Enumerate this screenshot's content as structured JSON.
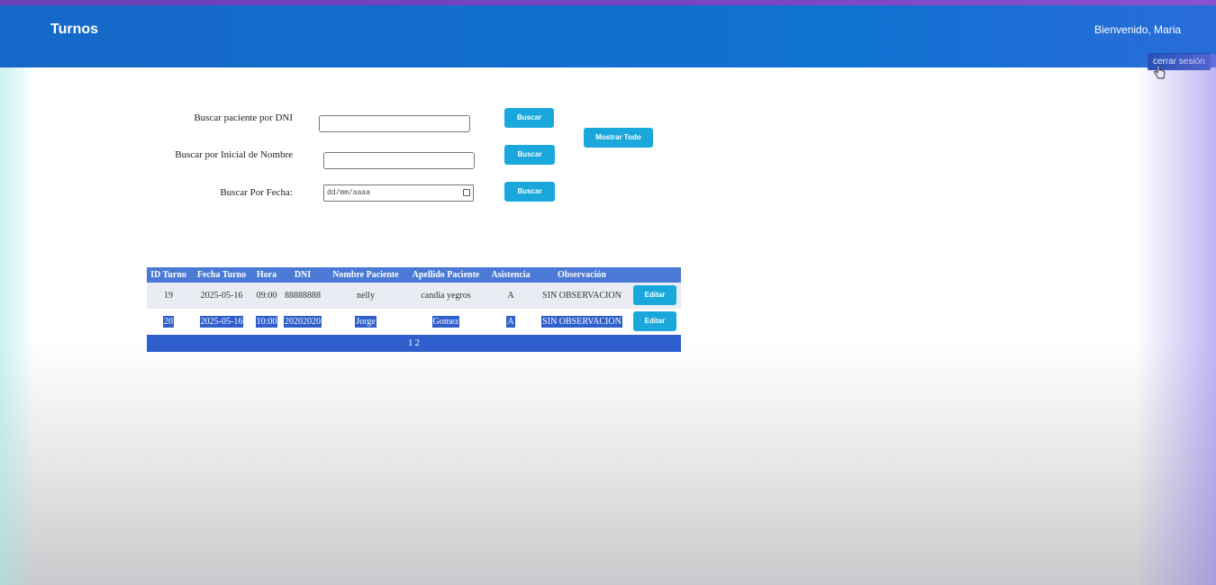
{
  "header": {
    "title": "Turnos",
    "welcome": "Bienvenido, Maria",
    "logout_label": "cerrar sesión"
  },
  "search": {
    "dni_label": "Buscar  paciente por DNI",
    "dni_value": "",
    "name_label": "Buscar por Inicial de Nombre",
    "name_value": "",
    "date_label": "Buscar Por Fecha:",
    "date_placeholder": "dd/mm/aaaa",
    "search_button": "Buscar",
    "show_all_button": "Mostrar Todo"
  },
  "table": {
    "columns": [
      "ID Turno",
      "Fecha Turno",
      "Hora",
      "DNI",
      "Nombre Paciente",
      "Apellido Paciente",
      "Asistencia",
      "Observación"
    ],
    "rows": [
      [
        "19",
        "2025-05-16",
        "09:00",
        "88888888",
        "nelly",
        "candia yegros",
        "A",
        "SIN OBSERVACION"
      ],
      [
        "20",
        "2025-05-16",
        "10:00",
        "20202020",
        "Jorge",
        "Gomez",
        "A",
        "SIN OBSERVACION"
      ]
    ],
    "edit_label": "Editar",
    "pages": [
      "1",
      "2"
    ]
  },
  "colors": {
    "header_bg": "#1568c8",
    "accent_button": "#1aa8dc",
    "table_header": "#4a7ad6",
    "selection": "#2f5fcc"
  }
}
